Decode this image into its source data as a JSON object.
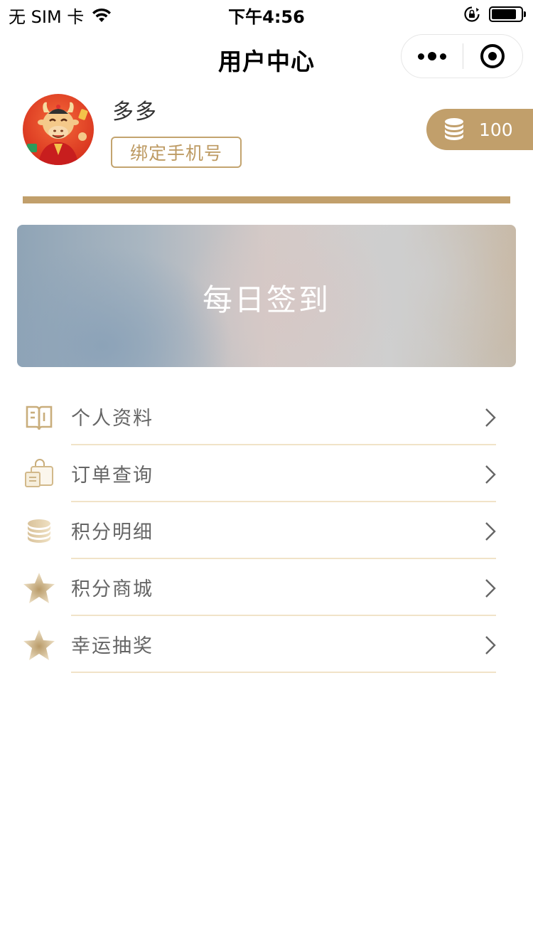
{
  "status_bar": {
    "carrier": "无 SIM 卡",
    "time": "下午4:56",
    "icons": [
      "wifi-icon",
      "orientation-lock-icon",
      "battery-icon"
    ]
  },
  "nav": {
    "title": "用户中心",
    "capsule": {
      "more_icon": "more-dots-icon",
      "close_icon": "target-circle-icon"
    }
  },
  "profile": {
    "name": "多多",
    "bind_phone_label": "绑定手机号",
    "points": "100",
    "points_icon": "coin-stack-icon"
  },
  "signin": {
    "label": "每日签到"
  },
  "menu": {
    "items": [
      {
        "label": "个人资料",
        "icon": "book-icon"
      },
      {
        "label": "订单查询",
        "icon": "shopping-bag-icon"
      },
      {
        "label": "积分明细",
        "icon": "coin-stack-icon"
      },
      {
        "label": "积分商城",
        "icon": "star-icon"
      },
      {
        "label": "幸运抽奖",
        "icon": "star-icon"
      }
    ]
  },
  "colors": {
    "accent": "#c19f6b",
    "divider": "#f1e3c8",
    "text_muted": "#666666"
  }
}
